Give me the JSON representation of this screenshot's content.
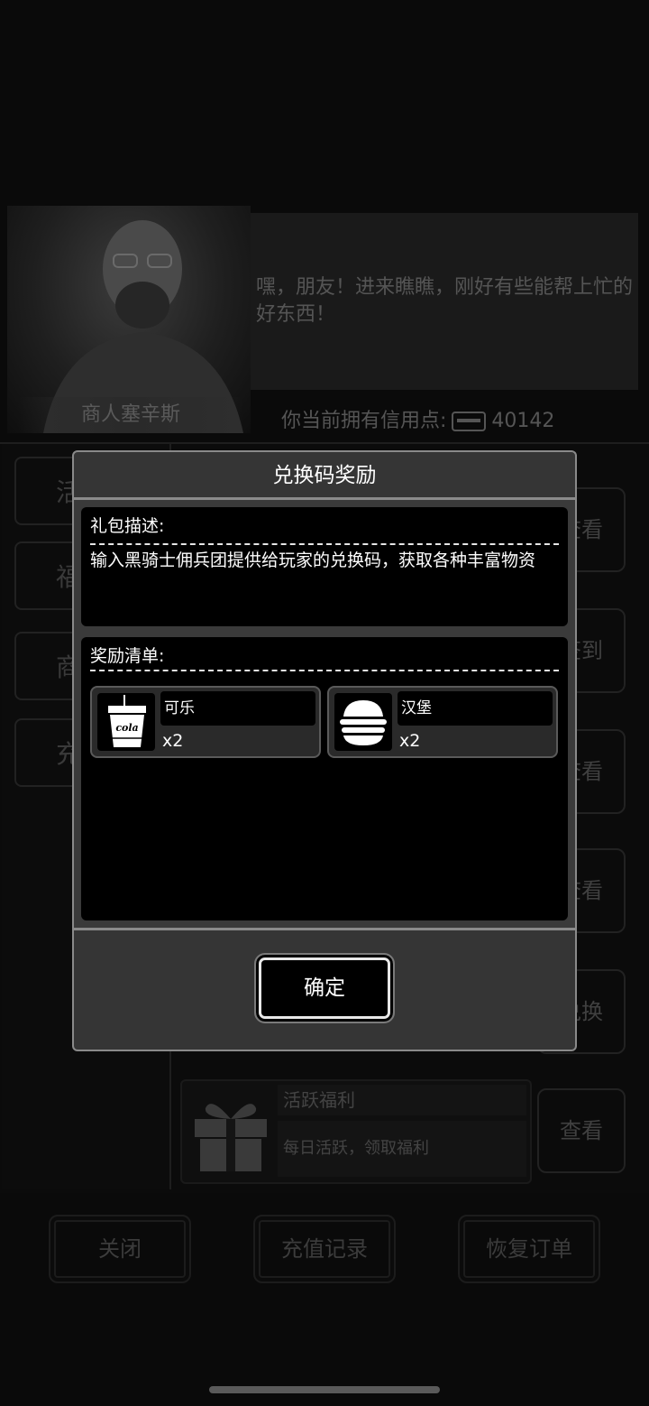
{
  "background": {
    "merchant_name": "商人塞辛斯",
    "speech": "嘿，朋友！进来瞧瞧，刚好有些能帮上忙的好东西！",
    "credits_label": "你当前拥有信用点:",
    "credits_value": "40142",
    "side_tabs": [
      "活",
      "福",
      "商",
      "充"
    ],
    "right_buttons": [
      "查看",
      "签到",
      "查看",
      "查看",
      "兑换",
      "查看"
    ],
    "welfare": {
      "title": "活跃福利",
      "desc": "每日活跃，领取福利"
    },
    "bottom_buttons": {
      "close": "关闭",
      "recharge_history": "充值记录",
      "restore_order": "恢复订单"
    }
  },
  "modal": {
    "title": "兑换码奖励",
    "desc_label": "礼包描述:",
    "desc_text": "输入黑骑士佣兵团提供给玩家的兑换码，获取各种丰富物资",
    "rewards_label": "奖励清单:",
    "rewards": [
      {
        "name": "可乐",
        "qty": "x2",
        "icon": "cola-icon",
        "icon_text": "cola"
      },
      {
        "name": "汉堡",
        "qty": "x2",
        "icon": "burger-icon"
      }
    ],
    "confirm_label": "确定"
  }
}
